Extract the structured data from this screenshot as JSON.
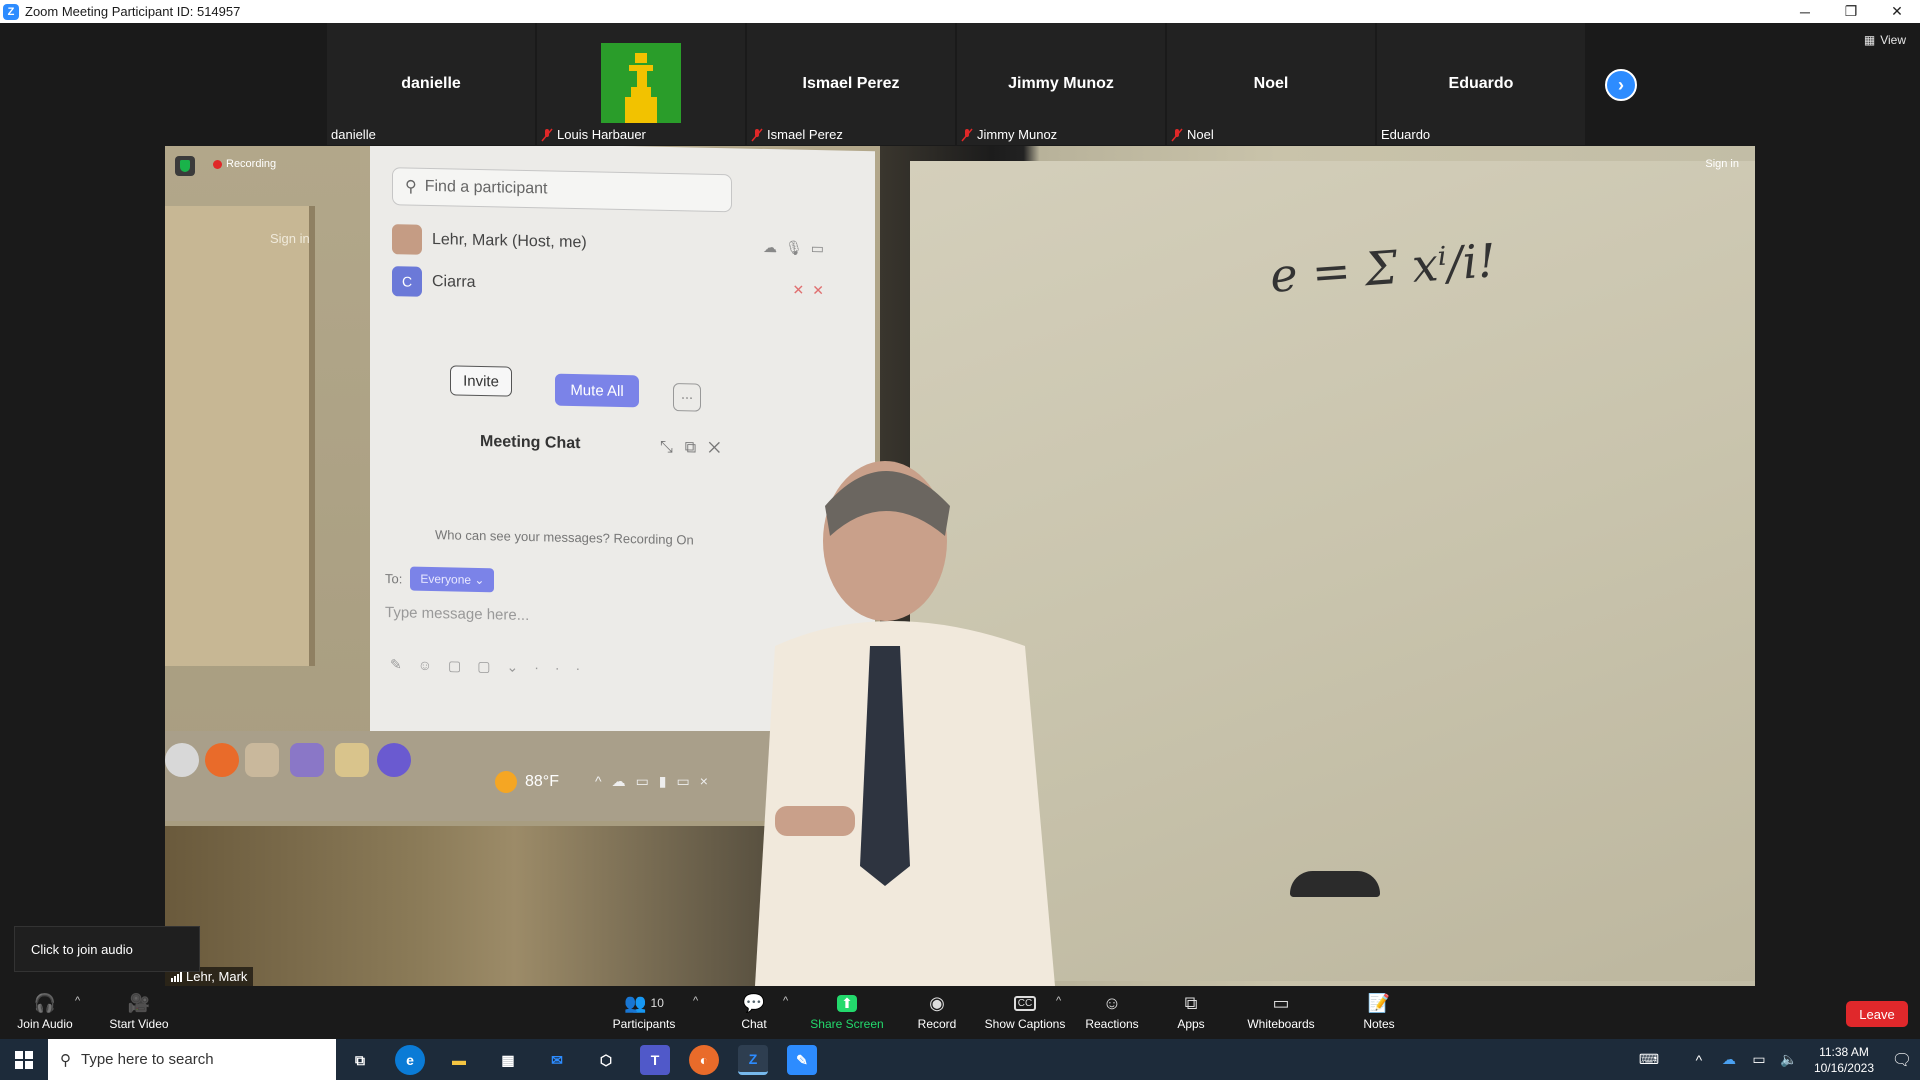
{
  "window": {
    "title": "Zoom Meeting Participant ID: 514957",
    "controls": [
      "─",
      "❐",
      "✕"
    ]
  },
  "gallery": {
    "tiles": [
      {
        "bigname": "danielle",
        "label": "danielle",
        "muted": false,
        "has_avatar": false
      },
      {
        "bigname": "",
        "label": "Louis Harbauer",
        "muted": true,
        "has_avatar": true
      },
      {
        "bigname": "Ismael Perez",
        "label": "Ismael Perez",
        "muted": true,
        "has_avatar": false
      },
      {
        "bigname": "Jimmy Munoz",
        "label": "Jimmy Munoz",
        "muted": true,
        "has_avatar": false
      },
      {
        "bigname": "Noel",
        "label": "Noel",
        "muted": true,
        "has_avatar": false
      },
      {
        "bigname": "Eduardo",
        "label": "Eduardo",
        "muted": false,
        "has_avatar": false
      }
    ],
    "view_label": "View"
  },
  "video": {
    "recording": "Recording",
    "signin_right": "Sign in",
    "signin_left": "Sign in",
    "speaker_name": "Lehr, Mark",
    "projected": {
      "search_placeholder": "Find a participant",
      "participants": [
        {
          "name": "Lehr, Mark (Host, me)"
        },
        {
          "name": "Ciarra",
          "initial": "C"
        }
      ],
      "invite": "Invite",
      "mute_all": "Mute All",
      "more": "···",
      "chat_title": "Meeting Chat",
      "who_can_see": "Who can see your messages? Recording On",
      "to_label": "To:",
      "to_value": "Everyone ⌄",
      "type_message": "Type message here...",
      "temperature": "88°F"
    },
    "equation": "e = Σ xⁱ/i!"
  },
  "tooltip": "Click to join audio",
  "toolbar": {
    "join_audio": "Join Audio",
    "start_video": "Start Video",
    "participants": "Participants",
    "participants_count": "10",
    "chat": "Chat",
    "share_screen": "Share Screen",
    "record": "Record",
    "show_captions": "Show Captions",
    "reactions": "Reactions",
    "apps": "Apps",
    "whiteboards": "Whiteboards",
    "notes": "Notes",
    "leave": "Leave",
    "caret": "^"
  },
  "taskbar": {
    "search_placeholder": "Type here to search",
    "time": "11:38 AM",
    "date": "10/16/2023"
  },
  "colors": {
    "accent": "#2d8cff",
    "leave": "#e0282b",
    "share": "#23d96c"
  }
}
